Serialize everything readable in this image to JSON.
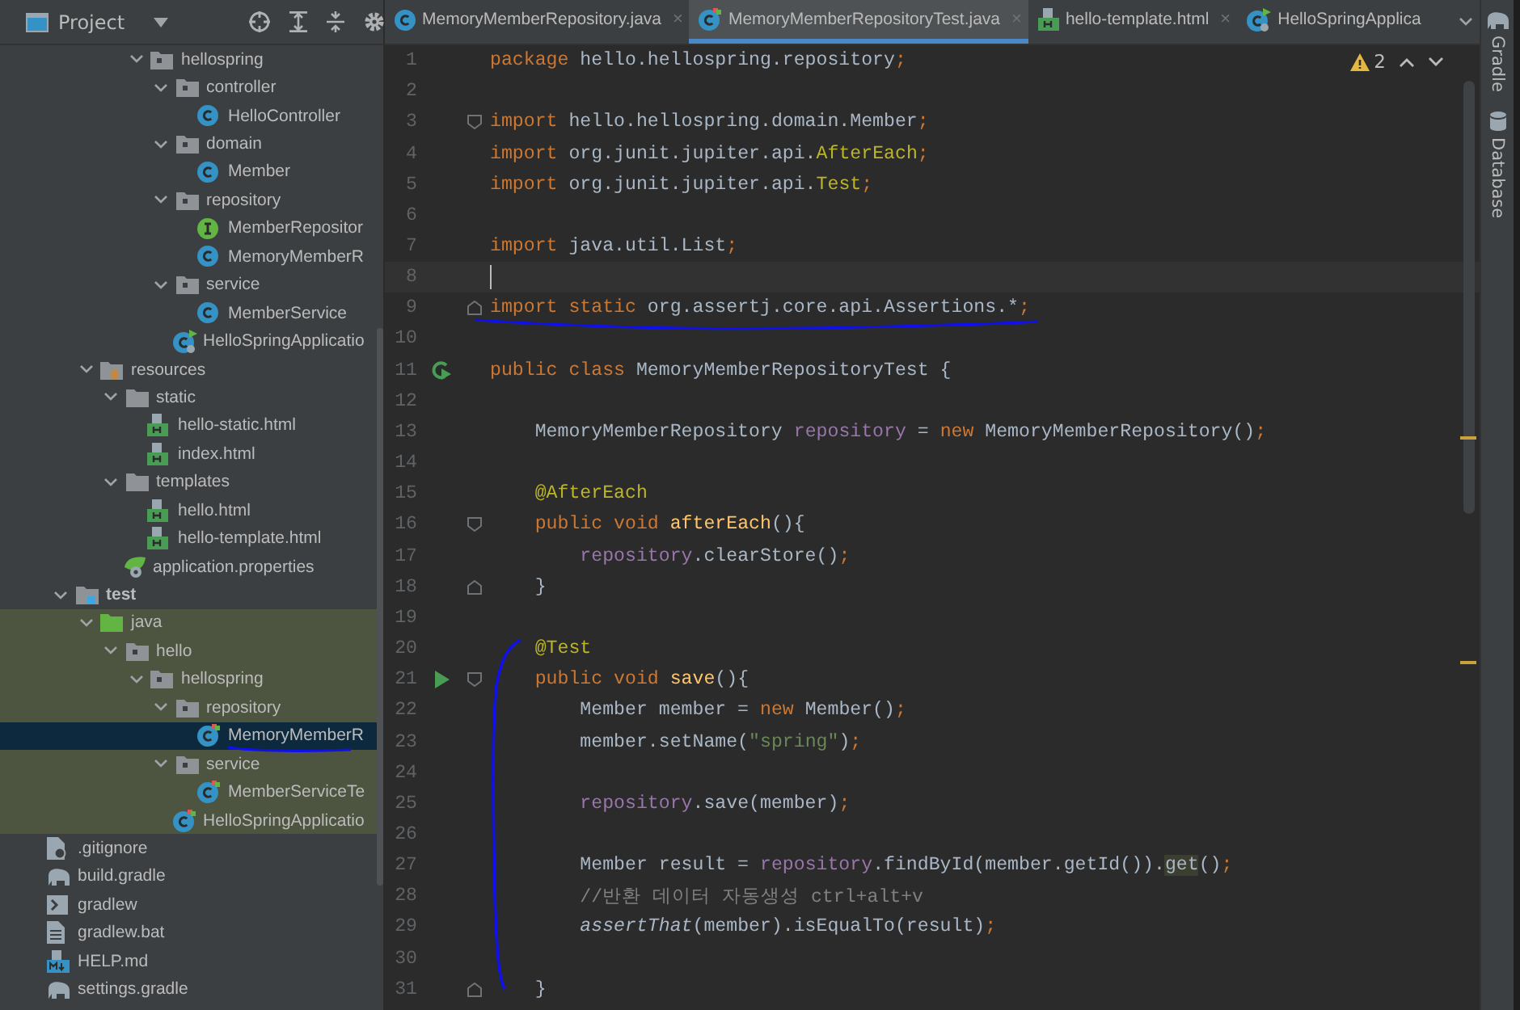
{
  "project_toolbar": {
    "title": "Project"
  },
  "tabs": [
    {
      "label": "MemoryMemberRepository.java",
      "kind": "class",
      "selected": false,
      "close": "×"
    },
    {
      "label": "MemoryMemberRepositoryTest.java",
      "kind": "test-class",
      "selected": true,
      "close": "×"
    },
    {
      "label": "hello-template.html",
      "kind": "html",
      "selected": false,
      "close": "×"
    },
    {
      "label": "HelloSpringApplica",
      "kind": "spring-app",
      "selected": false
    }
  ],
  "tree": [
    {
      "children": [
        {
          "children": [
            {
              "children": [
                {
                  "children": [
                    {
                      "label": "hellospring",
                      "kind": "package",
                      "expanded": true,
                      "selected": false,
                      "tinted": false,
                      "children": [
                        {
                          "label": "controller",
                          "kind": "package",
                          "expanded": true,
                          "selected": false,
                          "tinted": false,
                          "children": [
                            {
                              "label": "HelloController",
                              "kind": "class",
                              "selected": false,
                              "tinted": false
                            }
                          ]
                        },
                        {
                          "label": "domain",
                          "kind": "package",
                          "expanded": true,
                          "selected": false,
                          "tinted": false,
                          "children": [
                            {
                              "label": "Member",
                              "kind": "class",
                              "selected": false,
                              "tinted": false
                            }
                          ]
                        },
                        {
                          "label": "repository",
                          "kind": "package",
                          "expanded": true,
                          "selected": false,
                          "tinted": false,
                          "children": [
                            {
                              "label": "MemberRepositor",
                              "kind": "interface",
                              "selected": false,
                              "tinted": false
                            },
                            {
                              "label": "MemoryMemberR",
                              "kind": "class",
                              "selected": false,
                              "tinted": false
                            }
                          ]
                        },
                        {
                          "label": "service",
                          "kind": "package",
                          "expanded": true,
                          "selected": false,
                          "tinted": false,
                          "children": [
                            {
                              "label": "MemberService",
                              "kind": "class",
                              "selected": false,
                              "tinted": false
                            }
                          ]
                        },
                        {
                          "label": "HelloSpringApplicatio",
                          "kind": "spring-app",
                          "selected": false,
                          "tinted": false
                        }
                      ]
                    }
                  ]
                }
              ]
            },
            {
              "label": "resources",
              "kind": "resources-folder",
              "expanded": true,
              "selected": false,
              "tinted": false,
              "children": [
                {
                  "label": "static",
                  "kind": "folder",
                  "expanded": true,
                  "selected": false,
                  "tinted": false,
                  "children": [
                    {
                      "label": "hello-static.html",
                      "kind": "html",
                      "selected": false,
                      "tinted": false
                    },
                    {
                      "label": "index.html",
                      "kind": "html",
                      "selected": false,
                      "tinted": false
                    }
                  ]
                },
                {
                  "label": "templates",
                  "kind": "folder",
                  "expanded": true,
                  "selected": false,
                  "tinted": false,
                  "children": [
                    {
                      "label": "hello.html",
                      "kind": "html",
                      "selected": false,
                      "tinted": false
                    },
                    {
                      "label": "hello-template.html",
                      "kind": "html",
                      "selected": false,
                      "tinted": false
                    }
                  ]
                },
                {
                  "label": "application.properties",
                  "kind": "properties",
                  "selected": false,
                  "tinted": false
                }
              ]
            }
          ]
        },
        {
          "label": "test",
          "kind": "test-folder",
          "expanded": true,
          "selected": false,
          "tinted": false,
          "children": [
            {
              "label": "java",
              "kind": "source-folder",
              "expanded": true,
              "selected": false,
              "tinted": true,
              "children": [
                {
                  "label": "hello",
                  "kind": "package",
                  "expanded": true,
                  "selected": false,
                  "tinted": true,
                  "children": [
                    {
                      "label": "hellospring",
                      "kind": "package",
                      "expanded": true,
                      "selected": false,
                      "tinted": true,
                      "children": [
                        {
                          "label": "repository",
                          "kind": "package",
                          "expanded": true,
                          "selected": false,
                          "tinted": true,
                          "children": [
                            {
                              "label": "MemoryMemberR",
                              "kind": "test-class",
                              "selected": true,
                              "tinted": true
                            }
                          ]
                        },
                        {
                          "label": "service",
                          "kind": "package",
                          "expanded": true,
                          "selected": false,
                          "tinted": true,
                          "children": [
                            {
                              "label": "MemberServiceTe",
                              "kind": "test-class",
                              "selected": false,
                              "tinted": true
                            }
                          ]
                        },
                        {
                          "label": "HelloSpringApplicatio",
                          "kind": "test-class",
                          "selected": false,
                          "tinted": true
                        }
                      ]
                    }
                  ]
                }
              ]
            }
          ]
        }
      ]
    },
    {
      "label": ".gitignore",
      "kind": "gitignore",
      "selected": false,
      "tinted": false
    },
    {
      "label": "build.gradle",
      "kind": "gradle",
      "selected": false,
      "tinted": false
    },
    {
      "label": "gradlew",
      "kind": "terminal",
      "selected": false,
      "tinted": false
    },
    {
      "label": "gradlew.bat",
      "kind": "file",
      "selected": false,
      "tinted": false
    },
    {
      "label": "HELP.md",
      "kind": "markdown",
      "selected": false,
      "tinted": false
    },
    {
      "label": "settings.gradle",
      "kind": "gradle",
      "selected": false,
      "tinted": false
    }
  ],
  "editor": {
    "warnings": "2",
    "lines": [
      {
        "number": "1",
        "tokens": [
          {
            "kind": "k",
            "text": "package"
          },
          {
            "kind": "p",
            "text": " hello.hellospring.repository"
          },
          {
            "kind": "k",
            "text": ";"
          }
        ]
      },
      {
        "number": "2"
      },
      {
        "number": "3",
        "markers": [
          {
            "kind": "fold-start"
          }
        ],
        "tokens": [
          {
            "kind": "k",
            "text": "import"
          },
          {
            "kind": "p",
            "text": " hello.hellospring.domain.Member"
          },
          {
            "kind": "k",
            "text": ";"
          }
        ]
      },
      {
        "number": "4",
        "tokens": [
          {
            "kind": "k",
            "text": "import"
          },
          {
            "kind": "p",
            "text": " org.junit.jupiter.api."
          },
          {
            "kind": "a",
            "text": "AfterEach"
          },
          {
            "kind": "k",
            "text": ";"
          }
        ]
      },
      {
        "number": "5",
        "tokens": [
          {
            "kind": "k",
            "text": "import"
          },
          {
            "kind": "p",
            "text": " org.junit.jupiter.api."
          },
          {
            "kind": "a",
            "text": "Test"
          },
          {
            "kind": "k",
            "text": ";"
          }
        ]
      },
      {
        "number": "6"
      },
      {
        "number": "7",
        "tokens": [
          {
            "kind": "k",
            "text": "import"
          },
          {
            "kind": "p",
            "text": " java.util.List"
          },
          {
            "kind": "k",
            "text": ";"
          }
        ]
      },
      {
        "number": "8",
        "current": true
      },
      {
        "number": "9",
        "markers": [
          {
            "kind": "fold-end"
          }
        ],
        "tokens": [
          {
            "kind": "k",
            "text": "import static"
          },
          {
            "kind": "p",
            "text": " org.assertj.core.api.Assertions.*"
          },
          {
            "kind": "k",
            "text": ";"
          }
        ]
      },
      {
        "number": "10"
      },
      {
        "number": "11",
        "markers": [
          {
            "kind": "run-class"
          }
        ],
        "tokens": [
          {
            "kind": "k",
            "text": "public class"
          },
          {
            "kind": "p",
            "text": " MemoryMemberRepositoryTest {"
          }
        ]
      },
      {
        "number": "12"
      },
      {
        "number": "13",
        "tokens": [
          {
            "kind": "p",
            "text": "    MemoryMemberRepository "
          },
          {
            "kind": "f",
            "text": "repository"
          },
          {
            "kind": "p",
            "text": " = "
          },
          {
            "kind": "k",
            "text": "new"
          },
          {
            "kind": "p",
            "text": " MemoryMemberRepository()"
          },
          {
            "kind": "k",
            "text": ";"
          }
        ]
      },
      {
        "number": "14"
      },
      {
        "number": "15",
        "tokens": [
          {
            "kind": "a",
            "text": "    @AfterEach"
          }
        ]
      },
      {
        "number": "16",
        "markers": [
          {
            "kind": "fold-start"
          }
        ],
        "tokens": [
          {
            "kind": "k",
            "text": "    public void"
          },
          {
            "kind": "m",
            "text": " afterEach"
          },
          {
            "kind": "p",
            "text": "(){"
          }
        ]
      },
      {
        "number": "17",
        "tokens": [
          {
            "kind": "f",
            "text": "        repository"
          },
          {
            "kind": "p",
            "text": ".clearStore()"
          },
          {
            "kind": "k",
            "text": ";"
          }
        ]
      },
      {
        "number": "18",
        "markers": [
          {
            "kind": "fold-end"
          }
        ],
        "tokens": [
          {
            "kind": "p",
            "text": "    }"
          }
        ]
      },
      {
        "number": "19"
      },
      {
        "number": "20",
        "tokens": [
          {
            "kind": "a",
            "text": "    @Test"
          }
        ]
      },
      {
        "number": "21",
        "markers": [
          {
            "kind": "run"
          },
          {
            "kind": "fold-start"
          }
        ],
        "tokens": [
          {
            "kind": "k",
            "text": "    public void"
          },
          {
            "kind": "m",
            "text": " save"
          },
          {
            "kind": "p",
            "text": "(){"
          }
        ]
      },
      {
        "number": "22",
        "tokens": [
          {
            "kind": "p",
            "text": "        Member member = "
          },
          {
            "kind": "k",
            "text": "new"
          },
          {
            "kind": "p",
            "text": " Member()"
          },
          {
            "kind": "k",
            "text": ";"
          }
        ]
      },
      {
        "number": "23",
        "tokens": [
          {
            "kind": "p",
            "text": "        member.setName("
          },
          {
            "kind": "s",
            "text": "\"spring\""
          },
          {
            "kind": "p",
            "text": ")"
          },
          {
            "kind": "k",
            "text": ";"
          }
        ]
      },
      {
        "number": "24"
      },
      {
        "number": "25",
        "tokens": [
          {
            "kind": "f",
            "text": "        repository"
          },
          {
            "kind": "p",
            "text": ".save(member)"
          },
          {
            "kind": "k",
            "text": ";"
          }
        ]
      },
      {
        "number": "26"
      },
      {
        "number": "27",
        "tokens": [
          {
            "kind": "p",
            "text": "        Member result = "
          },
          {
            "kind": "f",
            "text": "repository"
          },
          {
            "kind": "p",
            "text": ".findById(member.getId())."
          },
          {
            "kind": "h",
            "text": "get"
          },
          {
            "kind": "p",
            "text": "()"
          },
          {
            "kind": "k",
            "text": ";"
          }
        ]
      },
      {
        "number": "28",
        "tokens": [
          {
            "kind": "c",
            "text": "        //반환 데이터 자동생성 ctrl+alt+v"
          }
        ]
      },
      {
        "number": "29",
        "tokens": [
          {
            "kind": "i",
            "text": "        assertThat"
          },
          {
            "kind": "p",
            "text": "(member).isEqualTo(result)"
          },
          {
            "kind": "k",
            "text": ";"
          }
        ]
      },
      {
        "number": "30"
      },
      {
        "number": "31",
        "markers": [
          {
            "kind": "fold-end"
          }
        ],
        "tokens": [
          {
            "kind": "p",
            "text": "    }"
          }
        ]
      }
    ]
  },
  "side_stripe": [
    {
      "label": "Gradle",
      "kind": "gradle"
    },
    {
      "label": "Database",
      "kind": "database"
    }
  ]
}
